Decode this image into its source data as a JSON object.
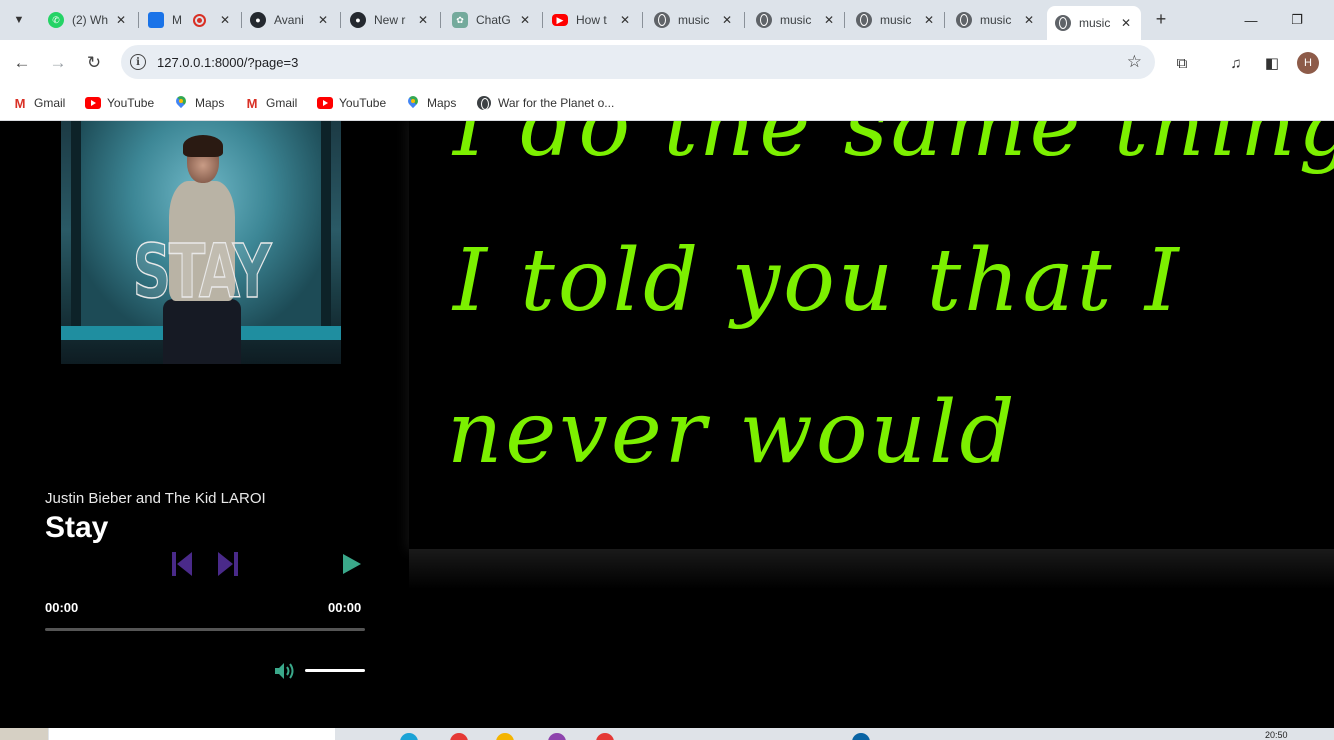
{
  "browser": {
    "tabs": [
      {
        "title": "(2) Wh",
        "icon": "whatsapp-icon",
        "color": "#25d366"
      },
      {
        "title": "M",
        "icon": "meet-icon",
        "color": "#1a73e8"
      },
      {
        "title": "Avani",
        "icon": "github-icon",
        "color": "#24292f"
      },
      {
        "title": "New r",
        "icon": "github-icon",
        "color": "#24292f"
      },
      {
        "title": "ChatG",
        "icon": "chatgpt-icon",
        "color": "#74aa9c"
      },
      {
        "title": "How t",
        "icon": "youtube-icon",
        "color": "#ff0000"
      },
      {
        "title": "music",
        "icon": "globe-icon",
        "color": "#5f6368"
      },
      {
        "title": "music",
        "icon": "globe-icon",
        "color": "#5f6368"
      },
      {
        "title": "music",
        "icon": "globe-icon",
        "color": "#5f6368"
      },
      {
        "title": "music",
        "icon": "globe-icon",
        "color": "#5f6368"
      },
      {
        "title": "music",
        "icon": "globe-icon",
        "color": "#5f6368",
        "active": true
      }
    ],
    "new_tab_label": "+",
    "url": "127.0.0.1:8000/?page=3",
    "profile_initial": "H",
    "bookmarks": [
      {
        "label": "Gmail",
        "icon": "gmail-icon"
      },
      {
        "label": "YouTube",
        "icon": "youtube-icon"
      },
      {
        "label": "Maps",
        "icon": "maps-icon"
      },
      {
        "label": "Gmail",
        "icon": "gmail-icon"
      },
      {
        "label": "YouTube",
        "icon": "youtube-icon"
      },
      {
        "label": "Maps",
        "icon": "maps-icon"
      },
      {
        "label": "War for the Planet o...",
        "icon": "globe-icon"
      }
    ]
  },
  "player": {
    "cover_text": "STAY",
    "artist": "Justin Bieber and The Kid LAROI",
    "title": "Stay",
    "current_time": "00:00",
    "duration": "00:00",
    "progress": 0,
    "volume": 1,
    "accent_color": "#4a2a8a",
    "play_color": "#3aa88a"
  },
  "lyrics": {
    "lines": [
      "I do the same thing,",
      "I told you that I",
      "never would"
    ],
    "color": "#7cf000"
  },
  "taskbar": {
    "clock": "20:50"
  }
}
